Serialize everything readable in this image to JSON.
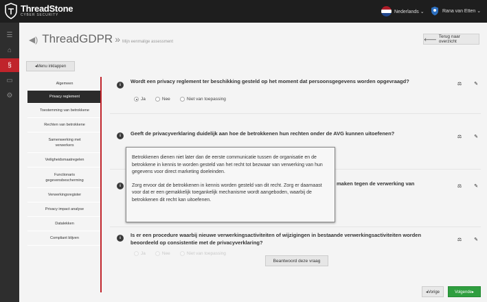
{
  "header": {
    "brand_name": "ThreadStone",
    "brand_sub": "CYBER SECURITY",
    "language": "Nederlands ⌄",
    "user": "Rana van Etten ⌄"
  },
  "page": {
    "title": "ThreadGDPR",
    "separator": "»",
    "subtitle": "Mijn eenmalige assessment",
    "back_label": "Terug naar overzicht",
    "collapse_label": "◂Menu inklappen"
  },
  "menu": {
    "items": [
      "Algemeen",
      "Privacy reglement",
      "Toestemming van betrokkene",
      "Rechten van betrokkene",
      "Samenwerking met verwerkers",
      "Veiligheidsmaatregelen",
      "Functionaris gegevensbescherming",
      "Verwerkingsregister",
      "Privacy impact analyse",
      "Datalekken",
      "Compliant blijven"
    ]
  },
  "questions": {
    "q1": "Wordt een privacy reglement ter beschikking gesteld op het moment dat persoonsgegevens worden opgevraagd?",
    "q2": "Geeft de privacyverklaring duidelijk aan hoe de betrokkenen hun rechten onder de AVG kunnen uitoefenen?",
    "q3_tail": "maken tegen de verwerking van",
    "q4": "Is er een procedure waarbij nieuwe verwerkingsactiviteiten of wijzigingen in bestaande verwerkingsactiviteiten worden beoordeeld op consistentie met de privacyverklaring?",
    "options": [
      "Ja",
      "Nee",
      "Niet van toepassing"
    ]
  },
  "tooltip": {
    "p1": "Betrokkenen dienen niet later dan de eerste communicatie tussen de organisatie en de betrokkene in kennis te worden gesteld van het recht tot bezwaar van verwerking van hun gegevens voor direct marketing doeleinden.",
    "p2": "Zorg ervoor dat de betrokkenen in kennis worden gesteld van dit recht. Zorg er daarnaast voor dat er een gemakkelijk toegankelijk mechanisme wordt aangeboden, waarbij de betrokkenen dit recht kan uitoefenen."
  },
  "footer": {
    "answer_label": "Beantwoord deze vraag",
    "prev_label": "◂Vorige",
    "next_label": "Volgende▸"
  },
  "colors": {
    "accent": "#c0242b",
    "next_button": "#2f9e3f",
    "topbar": "#1e1e1e"
  },
  "icons": [
    "shield-logo-icon",
    "netherlands-flag-icon",
    "user-shield-icon",
    "home-icon",
    "privacy-icon",
    "book-icon",
    "gear-icon",
    "info-icon",
    "gavel-icon",
    "comment-icon",
    "arrow-left-icon"
  ]
}
